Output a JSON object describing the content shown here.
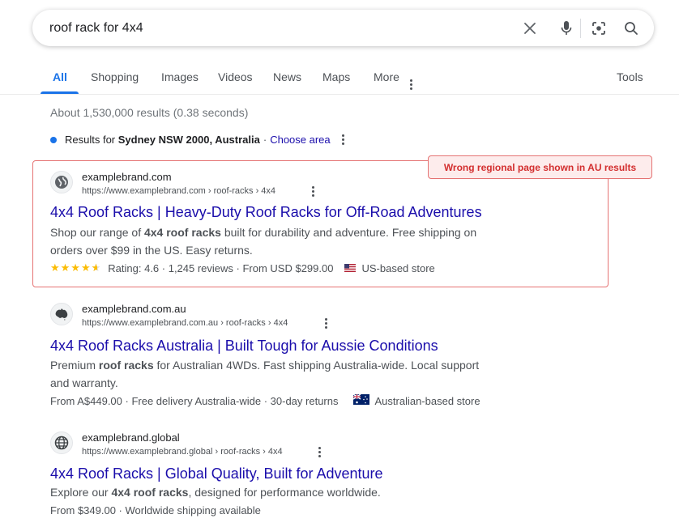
{
  "search": {
    "query": "roof rack for 4x4",
    "clear_icon": "close-icon",
    "voice_icon": "microphone-icon",
    "lens_icon": "lens-icon",
    "search_icon": "search-icon"
  },
  "tabs": [
    {
      "label": "All",
      "active": true
    },
    {
      "label": "Shopping"
    },
    {
      "label": "Images"
    },
    {
      "label": "Videos"
    },
    {
      "label": "News"
    },
    {
      "label": "Maps"
    },
    {
      "label": "More"
    }
  ],
  "tools_label": "Tools",
  "stats": "About 1,530,000 results (0.38 seconds)",
  "location": {
    "prefix": "Results for",
    "place": "Sydney NSW 2000, Australia",
    "separator": "·",
    "link": "Choose area"
  },
  "annotation": "Wrong regional page shown in AU results",
  "results": [
    {
      "site_name": "examplebrand.com",
      "url": "https://www.examplebrand.com › roof-racks › 4x4",
      "icon": "globe-icon",
      "title": "4x4 Roof Racks | Heavy-Duty Roof Racks for Off-Road Adventures",
      "snippet_1_pre": "Shop our range of ",
      "snippet_1_bold": "4x4 roof racks",
      "snippet_1_post": " built for durability and adventure. Free shipping on",
      "snippet_2": "orders over $99 in the US. Easy returns.",
      "rating_text": "Rating: 4.6 · 1,245 reviews · From USD $299.00",
      "rating_value": 4.6,
      "flag": "us-flag-icon",
      "store": "US-based store"
    },
    {
      "site_name": "examplebrand.com.au",
      "url": "https://www.examplebrand.com.au › roof-racks › 4x4",
      "icon": "australia-map-icon",
      "title": "4x4 Roof Racks Australia | Built Tough for Aussie Conditions",
      "snippet_1_pre": "Premium ",
      "snippet_1_bold": "roof racks",
      "snippet_1_post": " for Australian 4WDs. Fast shipping Australia-wide. Local support",
      "snippet_2": "and warranty.",
      "meta_text": "From A$449.00 · Free delivery Australia-wide · 30-day returns",
      "flag": "australia-flag-icon",
      "store": "Australian-based store"
    },
    {
      "site_name": "examplebrand.global",
      "url": "https://www.examplebrand.global › roof-racks › 4x4",
      "icon": "globe-grid-icon",
      "title": "4x4 Roof Racks | Global Quality, Built for Adventure",
      "snippet_1_pre": "Explore our ",
      "snippet_1_bold": "4x4 roof racks",
      "snippet_1_post": ", designed for performance worldwide.",
      "meta_text": "From $349.00 · Worldwide shipping available"
    }
  ],
  "colors": {
    "link": "#1a0dab",
    "accent": "#1a73e8",
    "highlight": "#e57373",
    "annotation_text": "#d32f2f",
    "star": "#fbbc04"
  }
}
